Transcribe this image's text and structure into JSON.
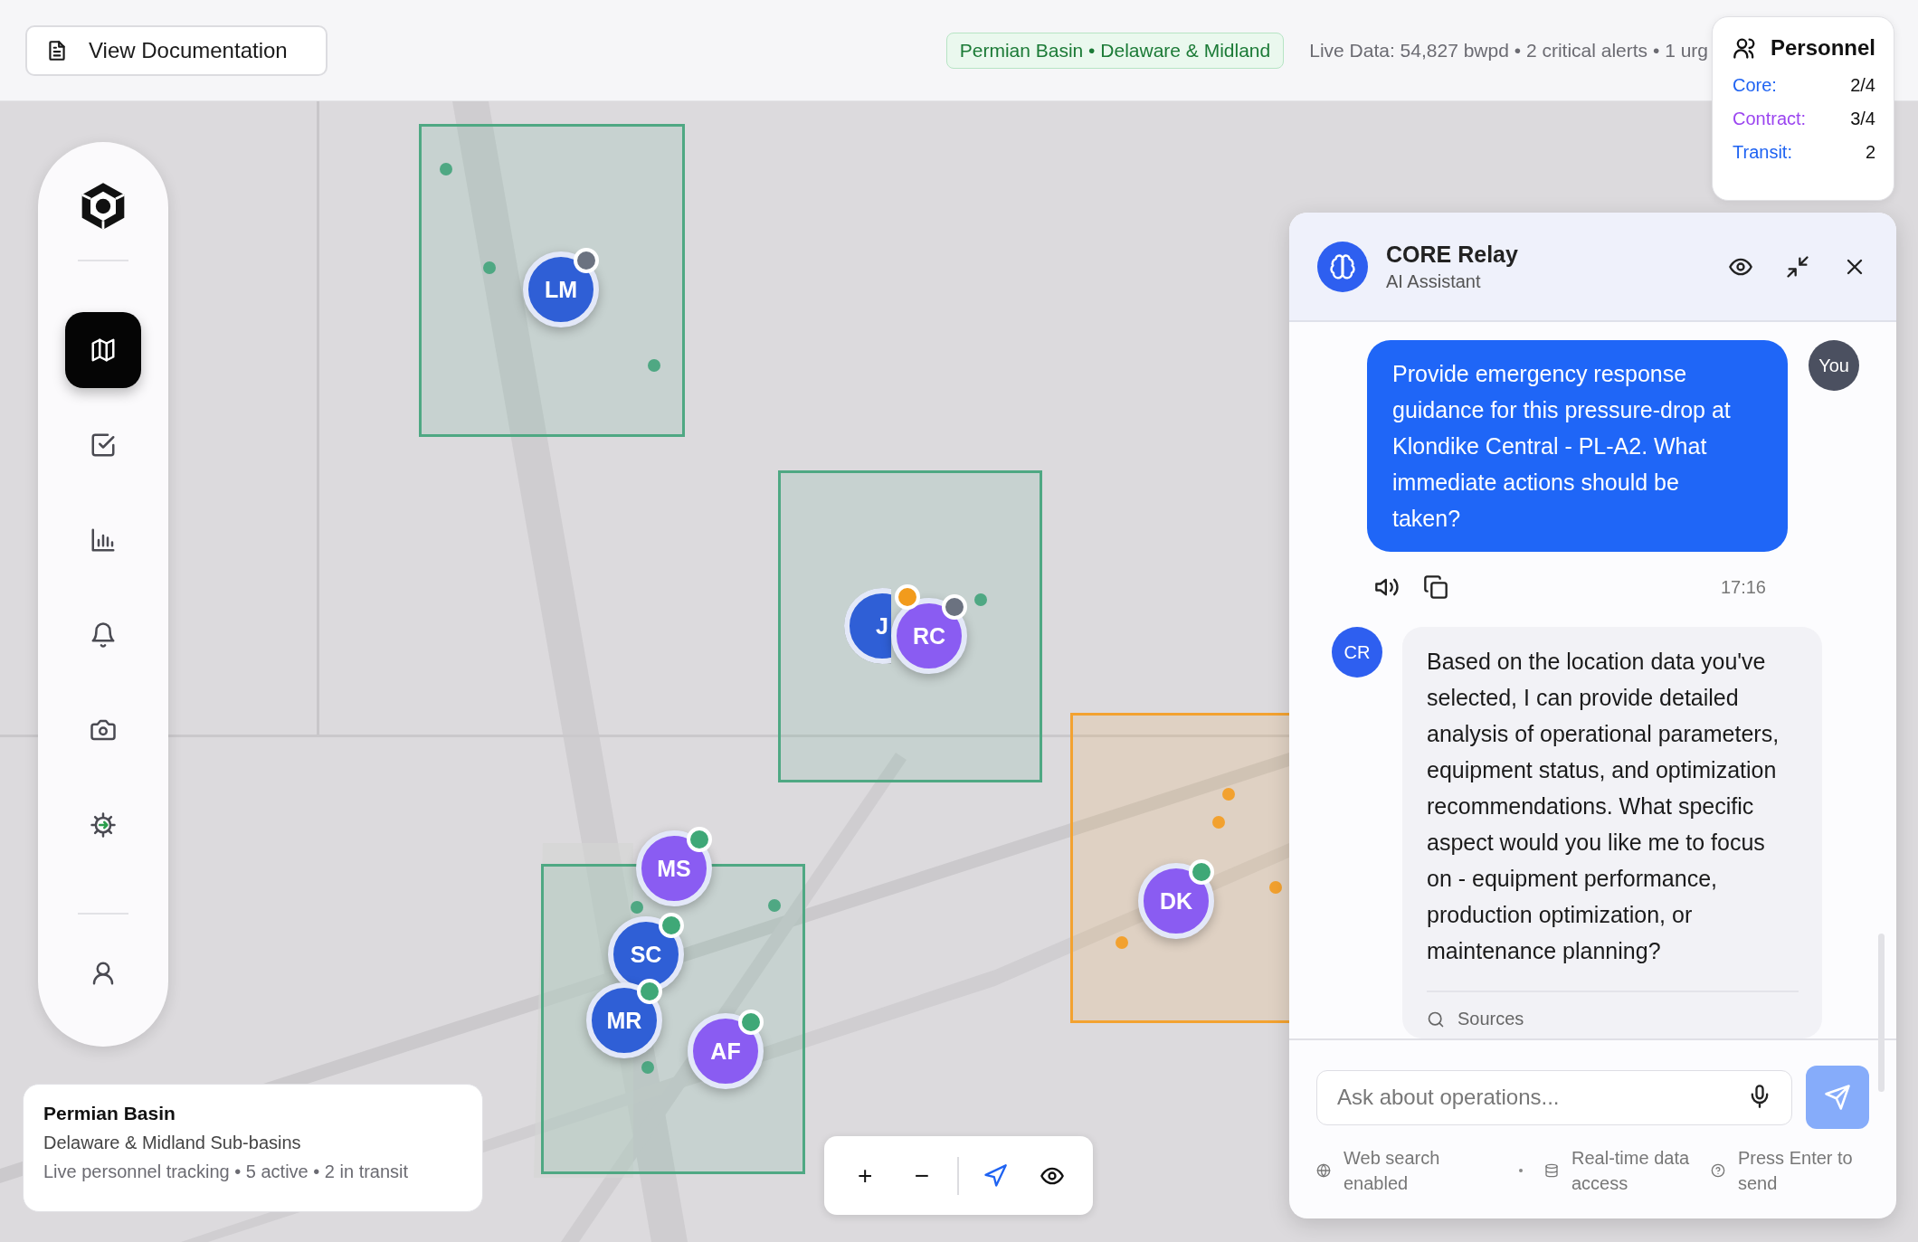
{
  "top_bar": {
    "doc_button": "View Documentation",
    "region_badge": "Permian Basin • Delaware & Midland",
    "live_status": "Live Data: 54,827 bwpd • 2 critical alerts • 1 urg"
  },
  "personnel": {
    "title": "Personnel",
    "rows": [
      {
        "label": "Core:",
        "value": "2/4",
        "color": "#1f63f2"
      },
      {
        "label": "Contract:",
        "value": "3/4",
        "color": "#9b45f0"
      },
      {
        "label": "Transit:",
        "value": "2",
        "color": "#1f63f2"
      }
    ]
  },
  "sidebar": {
    "nav_items": [
      {
        "kind": "map",
        "selected": true
      },
      {
        "kind": "tasks",
        "selected": false
      },
      {
        "kind": "analytics",
        "selected": false
      },
      {
        "kind": "alerts",
        "selected": false
      },
      {
        "kind": "camera",
        "selected": false
      },
      {
        "kind": "settings",
        "selected": false
      }
    ],
    "profile_item": {
      "kind": "profile",
      "selected": false
    }
  },
  "map": {
    "kind": "picture",
    "zones": [
      {
        "color": "#4fa883"
      },
      {
        "color": "#4fa883"
      },
      {
        "color": "#4fa883"
      },
      {
        "color": "#f3a230"
      }
    ],
    "markers": [
      {
        "initials": "LM",
        "color": "#2f5fd6",
        "status_dot": {
          "color": "#6b7280"
        }
      },
      {
        "initials": "J",
        "color": "#2f5fd6",
        "status_dot": {
          "color": "#f29b1c"
        }
      },
      {
        "initials": "RC",
        "color": "#8a5cf2",
        "status_dot": {
          "color": "#6b7280"
        }
      },
      {
        "initials": "MS",
        "color": "#8a5cf2",
        "status_dot": {
          "color": "#3fa877"
        }
      },
      {
        "initials": "SC",
        "color": "#2f5fd6",
        "status_dot": {
          "color": "#3fa877"
        }
      },
      {
        "initials": "MR",
        "color": "#2f5fd6",
        "status_dot": {
          "color": "#3fa877"
        }
      },
      {
        "initials": "AF",
        "color": "#8a5cf2",
        "status_dot": {
          "color": "#3fa877"
        }
      },
      {
        "initials": "DK",
        "color": "#8a5cf2",
        "status_dot": {
          "color": "#3fa877"
        }
      }
    ]
  },
  "info_card": {
    "title": "Permian Basin",
    "subtitle": "Delaware & Midland Sub-basins",
    "status": "Live personnel tracking • 5 active • 2 in transit"
  },
  "map_controls": {
    "zoom_in": "+",
    "zoom_out": "−"
  },
  "assistant": {
    "title": "CORE Relay",
    "subtitle": "AI Assistant",
    "messages": [
      {
        "kind": "user",
        "avatar": "You",
        "text": "Provide emergency response guidance for this pressure-drop at Klondike Central - PL-A2. What immediate actions should be taken?",
        "time": "17:16"
      },
      {
        "kind": "assistant",
        "avatar": "CR",
        "text": "Based on the location data you've selected, I can provide detailed analysis of operational parameters, equipment status, and optimization recommendations. What specific aspect would you like me to focus on - equipment performance, production optimization, or maintenance planning?",
        "sources": "Sources"
      }
    ],
    "input": {
      "placeholder": "Ask about operations..."
    },
    "send_disabled": true,
    "hints": [
      {
        "kind": "web",
        "text": "Web search enabled"
      },
      {
        "kind": "data",
        "text": "Real-time data access"
      },
      {
        "kind": "help",
        "text": "Press Enter to send"
      }
    ]
  }
}
